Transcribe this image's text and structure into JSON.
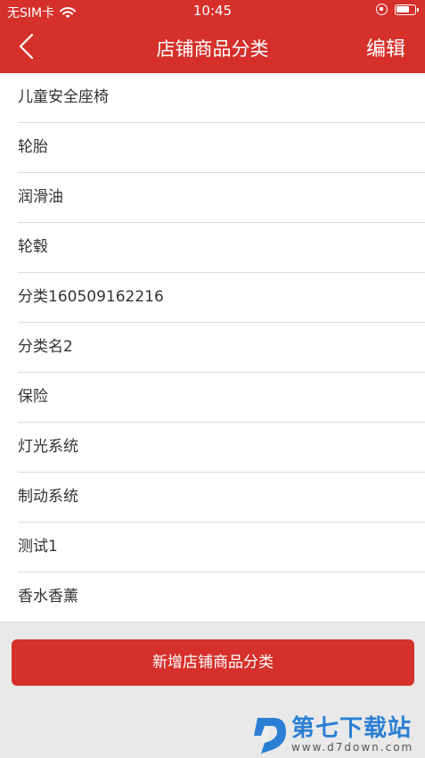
{
  "status_bar": {
    "carrier": "无SIM卡",
    "time": "10:45"
  },
  "nav": {
    "title": "店铺商品分类",
    "edit_label": "编辑"
  },
  "categories": [
    {
      "label": "儿童安全座椅"
    },
    {
      "label": "轮胎"
    },
    {
      "label": "润滑油"
    },
    {
      "label": "轮毂"
    },
    {
      "label": "分类160509162216"
    },
    {
      "label": "分类名2"
    },
    {
      "label": "保险"
    },
    {
      "label": "灯光系统"
    },
    {
      "label": "制动系统"
    },
    {
      "label": "测试1"
    },
    {
      "label": "香水香薰"
    }
  ],
  "footer": {
    "add_button_label": "新增店铺商品分类"
  },
  "watermark": {
    "name": "第七下载站",
    "url": "www.d7down.com"
  },
  "colors": {
    "accent": "#d5302b",
    "background": "#e9e9e9",
    "watermark": "#2a7fd4"
  }
}
